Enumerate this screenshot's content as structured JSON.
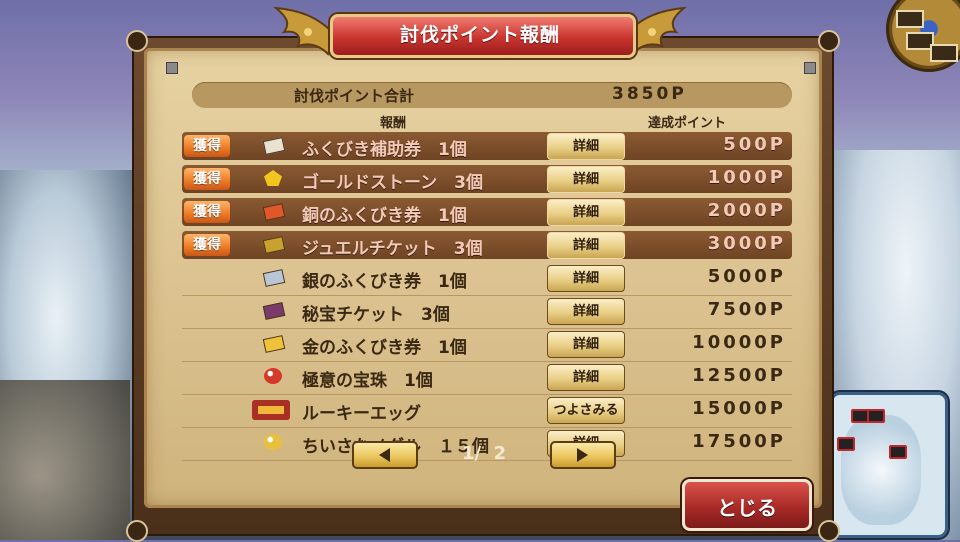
{
  "header": {
    "title": "討伐ポイント報酬"
  },
  "summary": {
    "total_label": "討伐ポイント合計",
    "total_value": "3850P"
  },
  "columns": {
    "reward": "報酬",
    "points": "達成ポイント"
  },
  "rewards": [
    {
      "acquired": true,
      "badge": "獲得",
      "icon": "ticket-icon",
      "icon_color": "#e9e2d0",
      "name": "ふくびき補助券　1個",
      "action": "詳細",
      "points": "500P"
    },
    {
      "acquired": true,
      "badge": "獲得",
      "icon": "gold-stone-icon",
      "icon_color": "#f2c51f",
      "name": "ゴールドストーン　3個",
      "action": "詳細",
      "points": "1000P"
    },
    {
      "acquired": true,
      "badge": "獲得",
      "icon": "ticket-icon",
      "icon_color": "#e2572a",
      "name": "銅のふくびき券　1個",
      "action": "詳細",
      "points": "2000P"
    },
    {
      "acquired": true,
      "badge": "獲得",
      "icon": "jewel-ticket-icon",
      "icon_color": "#c9a12e",
      "name": "ジュエルチケット　3個",
      "action": "詳細",
      "points": "3000P"
    },
    {
      "acquired": false,
      "badge": "",
      "icon": "ticket-icon",
      "icon_color": "#b9c6d6",
      "name": "銀のふくびき券　1個",
      "action": "詳細",
      "points": "5000P"
    },
    {
      "acquired": false,
      "badge": "",
      "icon": "treasure-ticket-icon",
      "icon_color": "#7a3b6b",
      "name": "秘宝チケット　3個",
      "action": "詳細",
      "points": "7500P"
    },
    {
      "acquired": false,
      "badge": "",
      "icon": "ticket-icon",
      "icon_color": "#efc23a",
      "name": "金のふくびき券　1個",
      "action": "詳細",
      "points": "10000P"
    },
    {
      "acquired": false,
      "badge": "",
      "icon": "orb-icon",
      "icon_color": "#d6382a",
      "name": "極意の宝珠　1個",
      "action": "詳細",
      "points": "12500P"
    },
    {
      "acquired": false,
      "badge": "",
      "icon": "egg-icon",
      "icon_color": "#a82f24",
      "name": "ルーキーエッグ",
      "action": "つよさみる",
      "points": "15000P"
    },
    {
      "acquired": false,
      "badge": "",
      "icon": "medal-icon",
      "icon_color": "#e7c13b",
      "name": "ちいさなメダル　１５個",
      "action": "詳細",
      "points": "17500P"
    }
  ],
  "pagination": {
    "current": "1",
    "separator": "/",
    "total": "2"
  },
  "close_label": "とじる"
}
